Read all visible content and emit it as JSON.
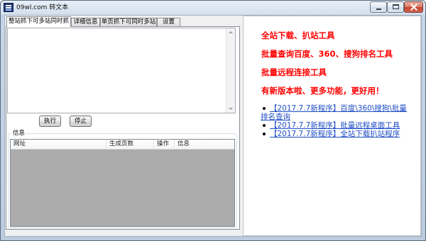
{
  "window": {
    "title": "09wl.com 转文本",
    "icon": "app-icon",
    "controls": [
      "minimize-icon",
      "maximize-icon",
      "close-icon"
    ]
  },
  "tabs": [
    {
      "label": "整站抓下可多站同时抓",
      "selected": true
    },
    {
      "label": "详细信息",
      "selected": false
    },
    {
      "label": "单页抓下可同时多站",
      "selected": false
    },
    {
      "label": "设置",
      "selected": false
    }
  ],
  "main": {
    "url_input": {
      "value": ""
    },
    "buttons": {
      "run": "执行",
      "stop": "停止"
    },
    "info_group": {
      "label": "信息",
      "columns": [
        "网址",
        "生成页数",
        "操作",
        "信息"
      ],
      "rows": []
    }
  },
  "promo": {
    "lines": [
      "全站下载、扒站工具",
      "批量查询百度、360、搜狗排名工具",
      "批量远程连接工具",
      "有新版本啦、更多功能，更好用！"
    ],
    "links": [
      {
        "text": "【2017.7.7新程序】百度\\360\\搜狗\\批量排名查询"
      },
      {
        "text": "【2017.7.7新程序】批量远程桌面工具"
      },
      {
        "text": "【2017.7.7新程序】全站下载扒站程序"
      }
    ]
  },
  "colors": {
    "promo_text": "#ff0000",
    "link": "#1f4ec5",
    "list_background": "#ababab"
  }
}
